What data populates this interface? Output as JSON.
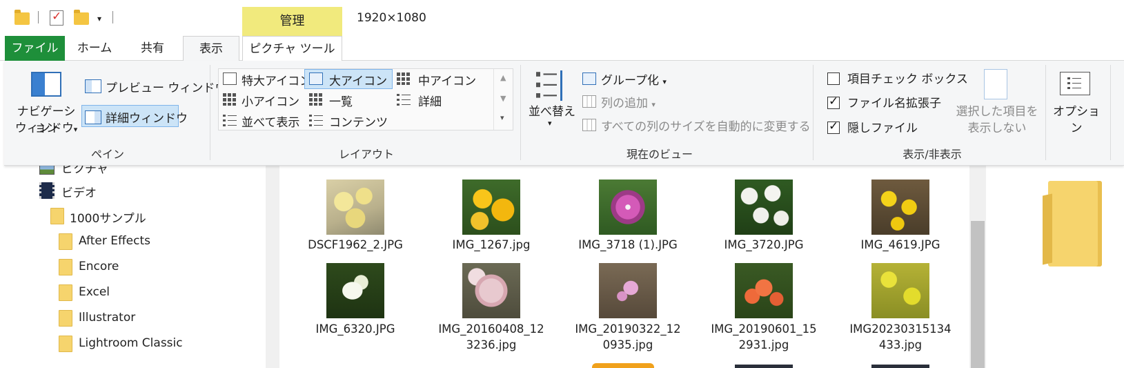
{
  "window": {
    "title": "1920×1080",
    "context_tab_group": "管理"
  },
  "tabs": [
    "ファイル",
    "ホーム",
    "共有",
    "表示",
    "ピクチャ ツール"
  ],
  "ribbon": {
    "pane": {
      "nav_pane_line1": "ナビゲーション",
      "nav_pane_line2": "ウィンドウ",
      "preview_pane": "プレビュー ウィンドウ",
      "details_pane": "詳細ウィンドウ",
      "label": "ペイン"
    },
    "layout": {
      "items": [
        "特大アイコン",
        "大アイコン",
        "中アイコン",
        "小アイコン",
        "一覧",
        "詳細",
        "並べて表示",
        "コンテンツ"
      ],
      "selected": "大アイコン",
      "label": "レイアウト"
    },
    "current_view": {
      "sort": "並べ替え",
      "group": "グループ化",
      "add_column": "列の追加",
      "autosize": "すべての列のサイズを自動的に変更する",
      "label": "現在のビュー"
    },
    "show_hide": {
      "item_checkbox": "項目チェック ボックス",
      "item_checkbox_checked": false,
      "extensions": "ファイル名拡張子",
      "extensions_checked": true,
      "hidden": "隠しファイル",
      "hidden_checked": true,
      "hide_selected_line1": "選択した項目を",
      "hide_selected_line2": "表示しない",
      "label": "表示/非表示"
    },
    "options": "オプション"
  },
  "nav": {
    "items": [
      "ピクチャ",
      "ビデオ",
      "1000サンプル",
      "After Effects",
      "Encore",
      "Excel",
      "Illustrator",
      "Lightroom Classic"
    ]
  },
  "files": {
    "row1": [
      "DSCF1962_2.JPG",
      "IMG_1267.jpg",
      "IMG_3718 (1).JPG",
      "IMG_3720.JPG",
      "IMG_4619.JPG"
    ],
    "row2_line1": [
      "IMG_6320.JPG",
      "IMG_20160408_12",
      "IMG_20190322_12",
      "IMG_20190601_15",
      "IMG20230315134"
    ],
    "row2_line2": [
      "",
      "3236.jpg",
      "0935.jpg",
      "2931.jpg",
      "433.jpg"
    ]
  },
  "colors": {
    "file_tab": "#1e8f3a",
    "context_tab": "#f1ea7d",
    "selection": "#cce4f7",
    "folder": "#f6d46d"
  }
}
